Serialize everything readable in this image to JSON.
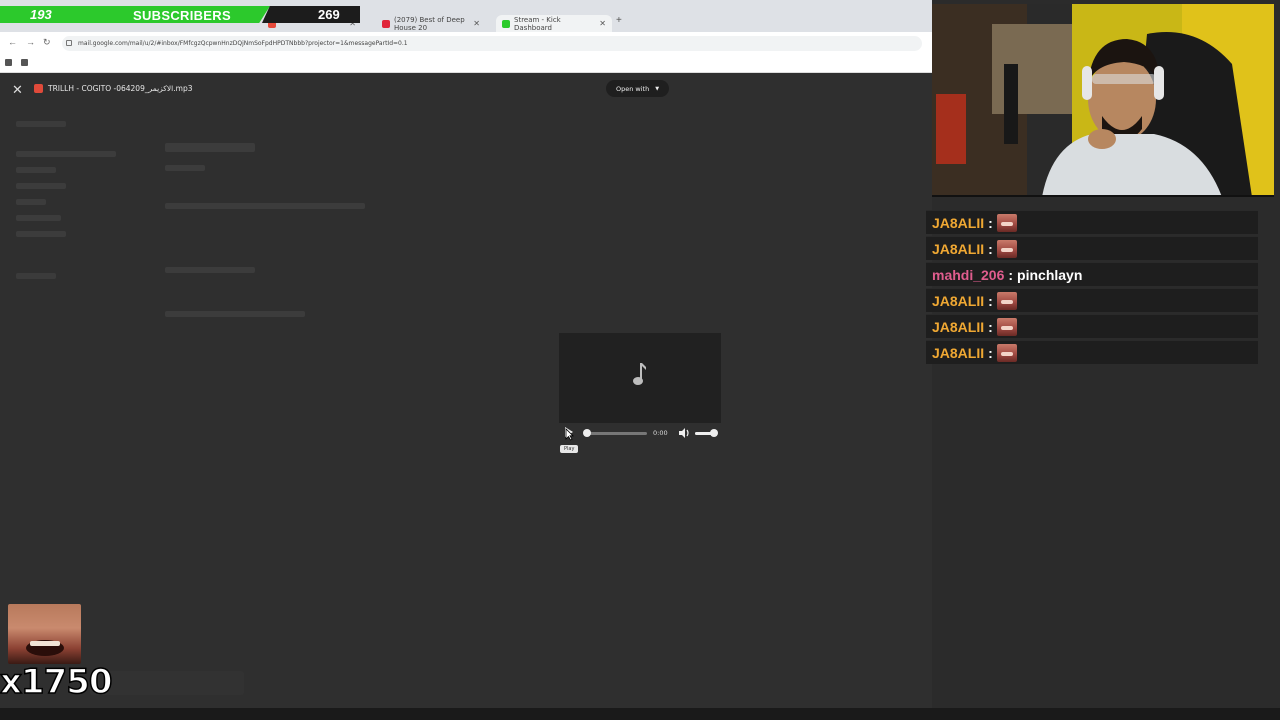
{
  "browser": {
    "tabs": [
      {
        "label": "",
        "color": "#e64a3b"
      },
      {
        "label": "(2079) Best of Deep House 20",
        "color": "#e0243a"
      },
      {
        "label": "Stream - Kick Dashboard",
        "color": "#2bcb2b"
      }
    ],
    "new_tab": "+",
    "url": "mail.google.com/mail/u/2/#inbox/FMfcgzQcpwnHnzDQjNmSoFpdHPDTNbbb?projector=1&messagePartId=0.1"
  },
  "subscribers": {
    "current": "193",
    "label": "SUBSCRIBERS",
    "goal": "269",
    "bar_color": "#2cc92c"
  },
  "viewer": {
    "close": "✕",
    "file_name": "TRILLH - COGITO -064209_الاكزيمر.mp3",
    "open_with": "Open with",
    "time": "0:00",
    "tooltip": "Play",
    "play_progress": 0,
    "volume_level": 0.85
  },
  "chat": {
    "messages": [
      {
        "user": "JA8ALII",
        "sep": ":",
        "text": "",
        "emote": true,
        "user_color": "#f0a833"
      },
      {
        "user": "JA8ALII",
        "sep": ":",
        "text": "",
        "emote": true,
        "user_color": "#f0a833"
      },
      {
        "user": "mahdi_206",
        "sep": ":",
        "text": "pinchlayn",
        "emote": false,
        "user_color": "#e05d8e"
      },
      {
        "user": "JA8ALII",
        "sep": ":",
        "text": "",
        "emote": true,
        "user_color": "#f0a833"
      },
      {
        "user": "JA8ALII",
        "sep": ":",
        "text": "",
        "emote": true,
        "user_color": "#f0a833"
      },
      {
        "user": "JA8ALII",
        "sep": ":",
        "text": "",
        "emote": true,
        "user_color": "#f0a833"
      }
    ]
  },
  "emote_counter": {
    "text": "x1750"
  },
  "icons": {
    "close": "close-icon",
    "file": "audio-file-icon",
    "note": "music-note-icon",
    "play": "play-icon",
    "volume": "volume-icon"
  }
}
